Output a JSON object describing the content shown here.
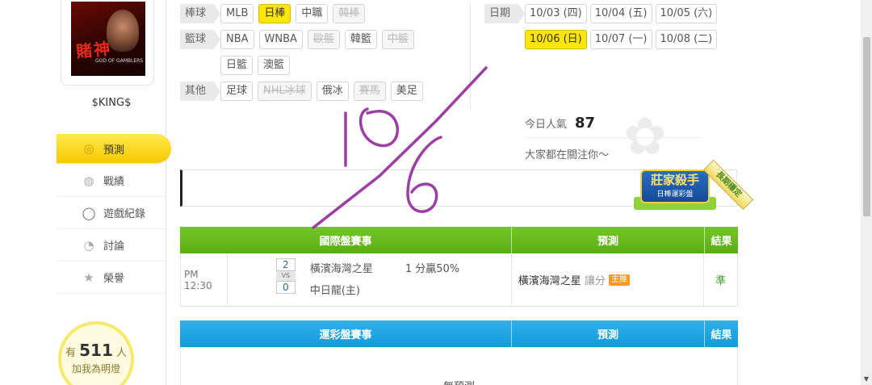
{
  "user": {
    "name": "$KING$",
    "avatar_title": "賭神",
    "avatar_sub": "GOD OF GAMBLERS"
  },
  "nav": [
    {
      "label": "預測",
      "icon": "target-icon",
      "active": true
    },
    {
      "label": "戰績",
      "icon": "chat-icon"
    },
    {
      "label": "遊戲紀錄",
      "icon": "circle-icon"
    },
    {
      "label": "討論",
      "icon": "comment-icon"
    },
    {
      "label": "榮譽",
      "icon": "medal-icon"
    }
  ],
  "lamp": {
    "pre": "有",
    "count": "511",
    "post": "人",
    "sub": "加我為明燈"
  },
  "filters": {
    "baseball": {
      "label": "棒球",
      "items": [
        "MLB",
        "日棒",
        "中職",
        "韓棒"
      ]
    },
    "basketball": {
      "label": "籃球",
      "items": [
        "NBA",
        "WNBA",
        "歐籃",
        "韓籃",
        "中籃"
      ],
      "row2": [
        "日籃",
        "澳籃"
      ]
    },
    "other": {
      "label": "其他",
      "items": [
        "足球",
        "NHL冰球",
        "俄冰",
        "賽馬",
        "美足"
      ]
    }
  },
  "dates": {
    "label": "日期",
    "row1": [
      "10/03 (四)",
      "10/04 (五)",
      "10/05 (六)"
    ],
    "row2": [
      "10/06 (日)",
      "10/07 (一)",
      "10/08 (二)"
    ]
  },
  "popularity": {
    "label": "今日人氣",
    "value": "87",
    "watch": "大家都在關注你～"
  },
  "badge": {
    "title": "莊家殺手",
    "sub": "日棒運彩盤",
    "ribbon": "長期穩定"
  },
  "intl_table": {
    "headers": [
      "國際盤賽事",
      "預測",
      "結果"
    ],
    "row": {
      "time": "PM 12:30",
      "score_home": "2",
      "vs": "VS",
      "score_away": "0",
      "team1": "橫濱海灣之星",
      "team2": "中日龍(主)",
      "odds": "1 分贏50%",
      "pred_team": "橫濱海灣之星",
      "pred_type": "讓分",
      "pred_tag": "主推",
      "result": "準"
    }
  },
  "sports_table": {
    "headers": [
      "運彩盤賽事",
      "預測",
      "結果"
    ],
    "empty": "無預測"
  },
  "colors": {
    "accent_yellow": "#ffe600",
    "green_header": "#5aae12",
    "blue_header": "#139adb",
    "annotation": "#9b3fa3"
  }
}
